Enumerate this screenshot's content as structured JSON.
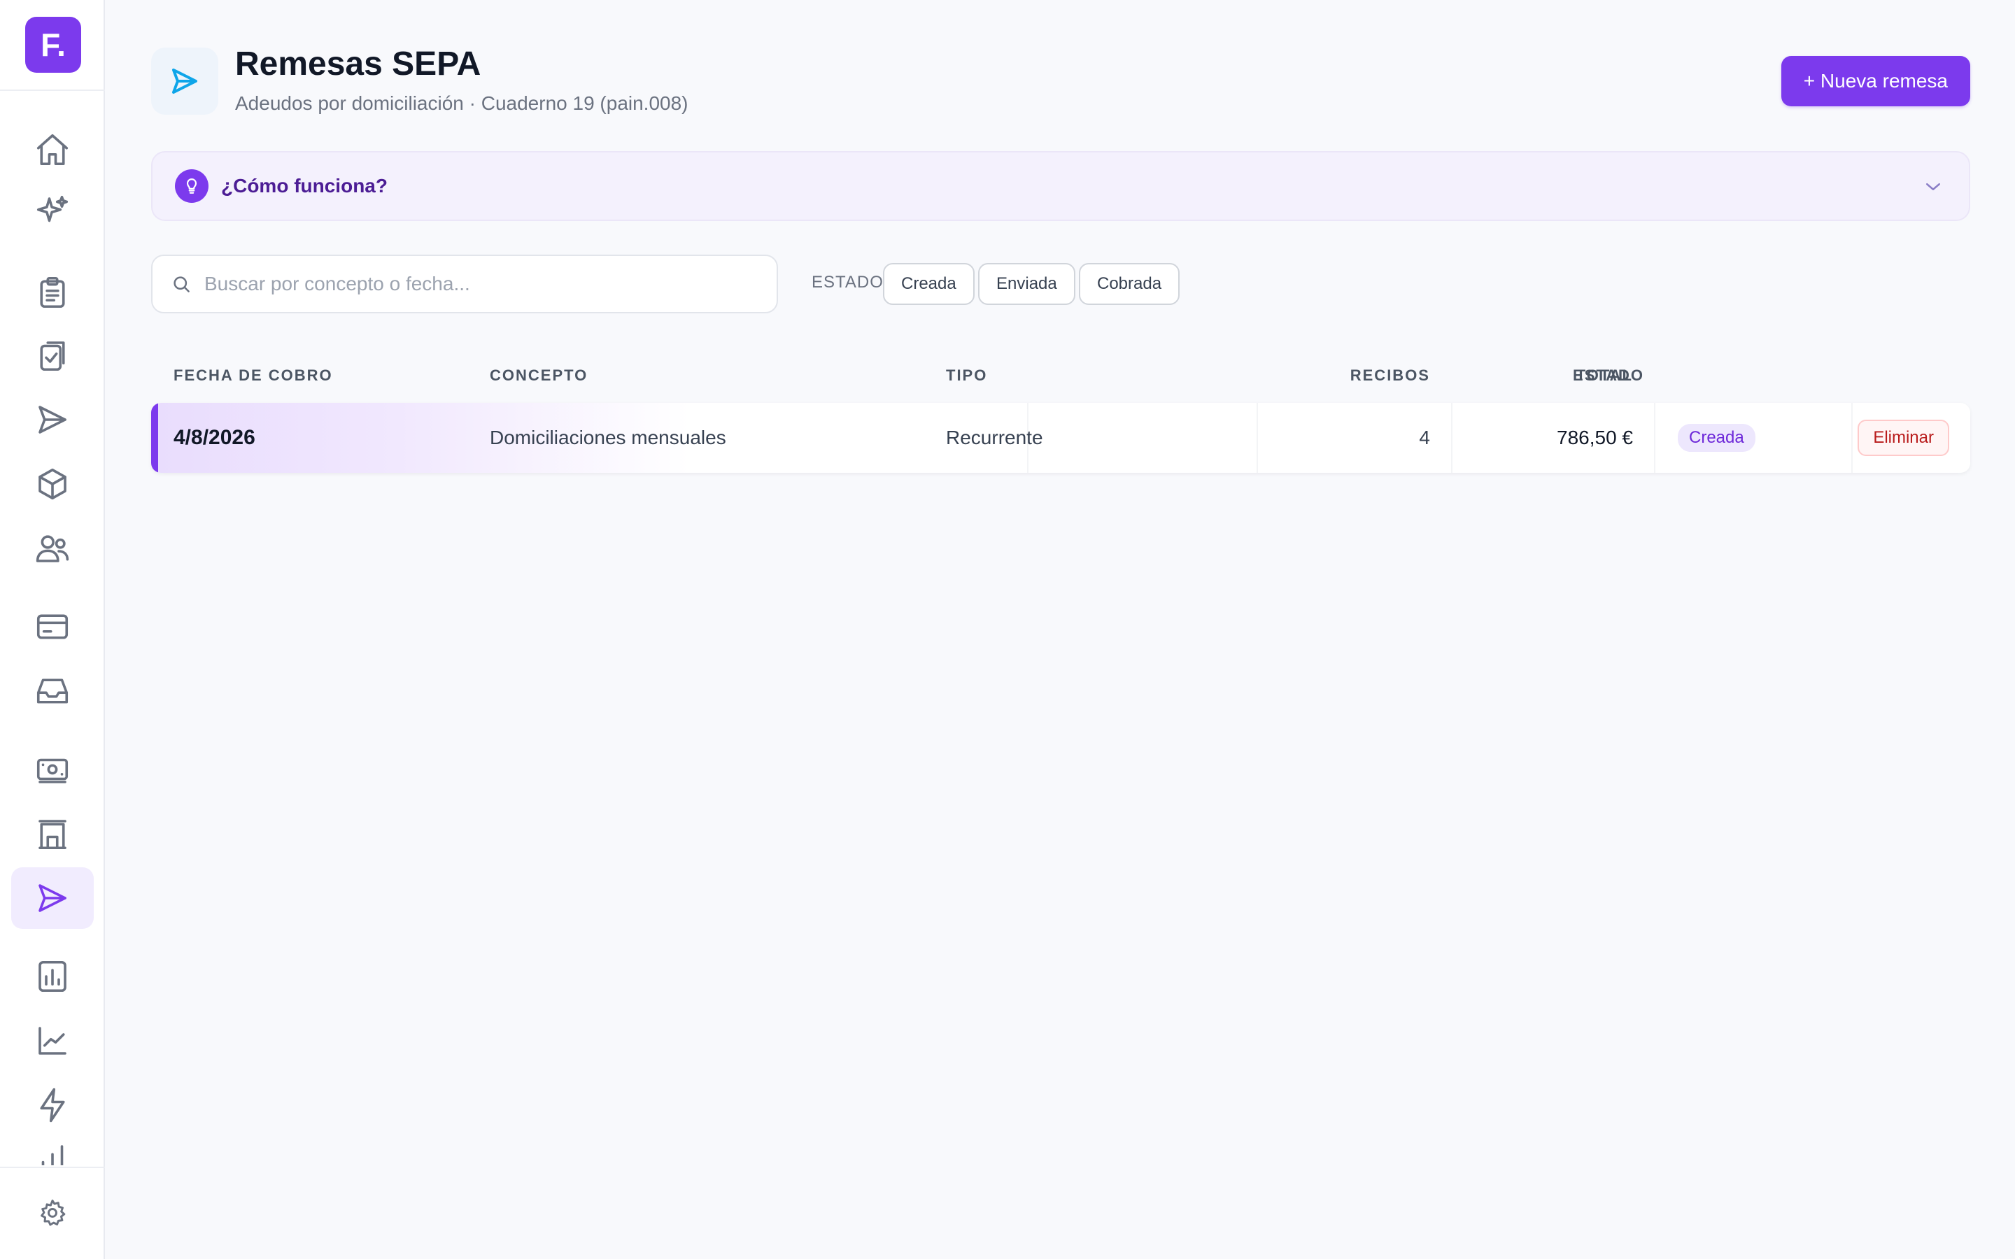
{
  "sidebar": {
    "logo_text": "F.",
    "items": [
      {
        "name": "home-icon"
      },
      {
        "name": "sparkles-icon"
      },
      {
        "name": "clipboard-list-icon"
      },
      {
        "name": "clipboard-check-icon"
      },
      {
        "name": "send-icon"
      },
      {
        "name": "cube-icon"
      },
      {
        "name": "users-icon"
      },
      {
        "name": "credit-card-icon"
      },
      {
        "name": "inbox-icon"
      },
      {
        "name": "banknote-icon"
      },
      {
        "name": "building-icon"
      },
      {
        "name": "send-icon",
        "active": true
      },
      {
        "name": "report-icon"
      },
      {
        "name": "line-chart-icon"
      },
      {
        "name": "lightning-icon"
      },
      {
        "name": "bar-chart-icon"
      },
      {
        "name": "settings-icon"
      }
    ],
    "active_color": "#7c3aed"
  },
  "header": {
    "title": "Remesas SEPA",
    "subtitle": "Adeudos por domiciliación · Cuaderno 19 (pain.008)",
    "primary_button": "+ Nueva remesa",
    "icon": "send-icon"
  },
  "howto": {
    "label": "¿Cómo funciona?",
    "icon": "lightbulb-icon"
  },
  "search": {
    "placeholder": "Buscar por concepto o fecha...",
    "value": ""
  },
  "filters": {
    "label": "ESTADO",
    "options": [
      "Creada",
      "Enviada",
      "Cobrada"
    ]
  },
  "table": {
    "headers": {
      "fecha": "Fecha de cobro",
      "concepto": "Concepto",
      "tipo": "Tipo",
      "recibos": "Recibos",
      "total": "Total",
      "estado": "Estado"
    },
    "rows": [
      {
        "fecha": "4/8/2026",
        "concepto": "Domiciliaciones mensuales",
        "tipo": "Recurrente",
        "recibos": "4",
        "total": "786,50 €",
        "estado": "Creada",
        "action": "Eliminar"
      }
    ]
  },
  "colors": {
    "accent": "#7c3aed",
    "danger": "#b91c1c",
    "badge_bg": "#ede7fd"
  }
}
